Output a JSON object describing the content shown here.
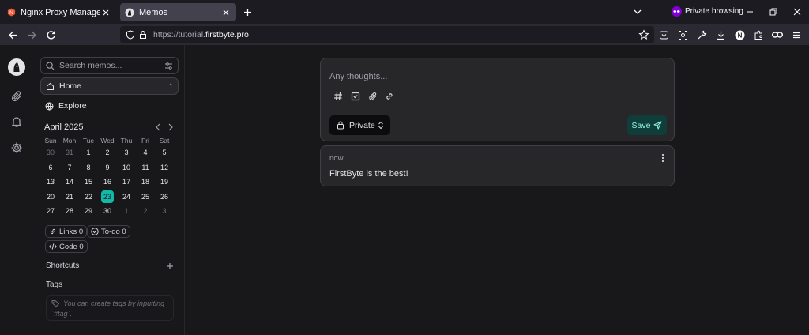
{
  "browser": {
    "tabs": [
      {
        "title": "Nginx Proxy Manager",
        "active": false
      },
      {
        "title": "Memos",
        "active": true
      }
    ],
    "private_label": "Private browsing",
    "url_prefix": "https://tutorial.",
    "url_host": "firstbyte.pro"
  },
  "sidebar": {
    "search_placeholder": "Search memos...",
    "nav": [
      {
        "label": "Home",
        "count": "1"
      },
      {
        "label": "Explore"
      }
    ],
    "calendar": {
      "title": "April 2025",
      "weekdays": [
        "Sun",
        "Mon",
        "Tue",
        "Wed",
        "Thu",
        "Fri",
        "Sat"
      ],
      "rows": [
        [
          "30",
          "31",
          "1",
          "2",
          "3",
          "4",
          "5"
        ],
        [
          "6",
          "7",
          "8",
          "9",
          "10",
          "11",
          "12"
        ],
        [
          "13",
          "14",
          "15",
          "16",
          "17",
          "18",
          "19"
        ],
        [
          "20",
          "21",
          "22",
          "23",
          "24",
          "25",
          "26"
        ],
        [
          "27",
          "28",
          "29",
          "30",
          "1",
          "2",
          "3"
        ]
      ],
      "today": "23"
    },
    "stats": [
      {
        "label": "Links 0",
        "icon": "link-icon"
      },
      {
        "label": "To-do 0",
        "icon": "check-circle-icon"
      },
      {
        "label": "Code 0",
        "icon": "code-icon"
      }
    ],
    "shortcuts_label": "Shortcuts",
    "tags_label": "Tags",
    "tags_hint": "You can create tags by inputting `#tag`."
  },
  "editor": {
    "placeholder": "Any thoughts...",
    "visibility": "Private",
    "save_label": "Save"
  },
  "memos": [
    {
      "time": "now",
      "content": "FirstByte is the best!"
    }
  ],
  "colors": {
    "accent": "#14b8a6",
    "background": "#18181b",
    "card": "#27272a"
  }
}
